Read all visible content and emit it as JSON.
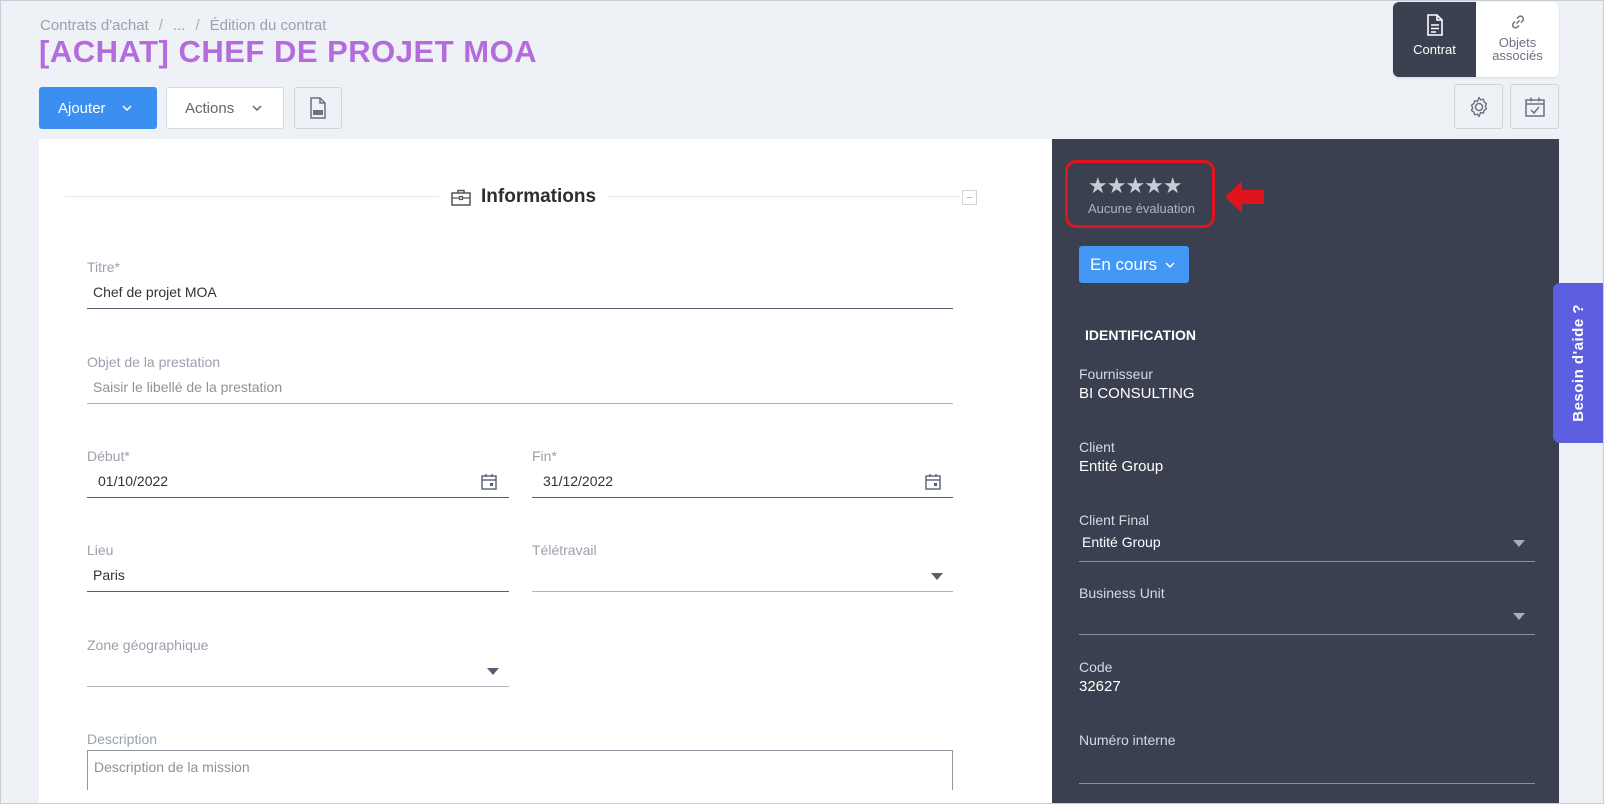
{
  "breadcrumb": {
    "item1": "Contrats d'achat",
    "sep1": "/",
    "item2": "...",
    "sep2": "/",
    "item3": "Édition du contrat"
  },
  "page_title": "[ACHAT] CHEF DE PROJET MOA",
  "tabs": {
    "contract": "Contrat",
    "related_line1": "Objets",
    "related_line2": "associés"
  },
  "toolbar": {
    "add_label": "Ajouter",
    "actions_label": "Actions"
  },
  "section": {
    "title": "Informations",
    "collapse": "–"
  },
  "form": {
    "titre": {
      "label": "Titre*",
      "value": "Chef de projet MOA"
    },
    "objet": {
      "label": "Objet de la prestation",
      "placeholder": "Saisir le libellé de la prestation"
    },
    "debut": {
      "label": "Début*",
      "value": "01/10/2022"
    },
    "fin": {
      "label": "Fin*",
      "value": "31/12/2022"
    },
    "lieu": {
      "label": "Lieu",
      "value": "Paris"
    },
    "teletravail": {
      "label": "Télétravail",
      "value": ""
    },
    "zone": {
      "label": "Zone géographique",
      "value": ""
    },
    "description": {
      "label": "Description",
      "placeholder": "Description de la mission"
    }
  },
  "panel": {
    "stars": "★★★★★",
    "rating_label": "Aucune évaluation",
    "rating": 0,
    "status": "En cours",
    "identification_title": "IDENTIFICATION",
    "fournisseur": {
      "label": "Fournisseur",
      "value": "BI CONSULTING"
    },
    "client": {
      "label": "Client",
      "value": "Entité Group"
    },
    "client_final": {
      "label": "Client Final",
      "value": "Entité Group"
    },
    "business_unit": {
      "label": "Business Unit",
      "value": ""
    },
    "code": {
      "label": "Code",
      "value": "32627"
    },
    "numero_interne": {
      "label": "Numéro interne",
      "value": ""
    }
  },
  "help": {
    "label": "Besoin d'aide ?"
  },
  "colors": {
    "title": "#b46cdc",
    "primary": "#3b8ff0",
    "panel": "#3a4050",
    "highlight": "#e0141e",
    "help": "#5d5fe0"
  }
}
